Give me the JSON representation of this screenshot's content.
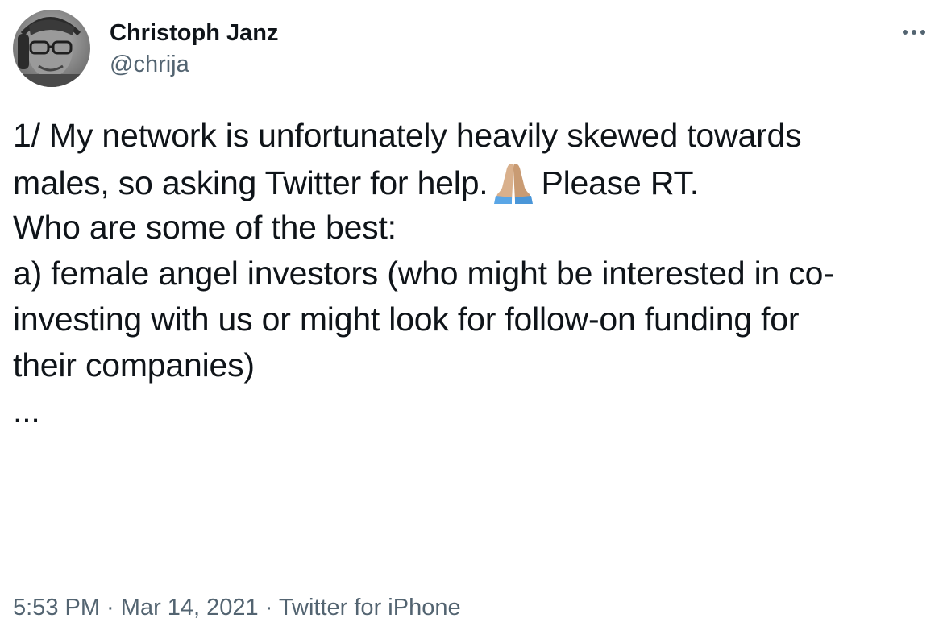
{
  "author": {
    "display_name": "Christoph Janz",
    "handle": "@chrija"
  },
  "more_label": "···",
  "tweet": {
    "line1": "1/ My network is unfortunately heavily skewed towards",
    "line2_before": "males, so asking Twitter for help.",
    "emoji": "folded-hands-emoji",
    "line2_after": "Please RT.",
    "line3": "Who are some of the best:",
    "line4": "a) female angel investors (who might be interested in co-",
    "line5": "investing with us or might look for follow-on funding for",
    "line6": "their companies)",
    "line7": "..."
  },
  "meta": {
    "time": "5:53 PM",
    "sep1": " · ",
    "date": "Mar 14, 2021",
    "sep2": " · ",
    "source": "Twitter for iPhone"
  },
  "colors": {
    "text": "#0f1419",
    "secondary": "#536471"
  }
}
